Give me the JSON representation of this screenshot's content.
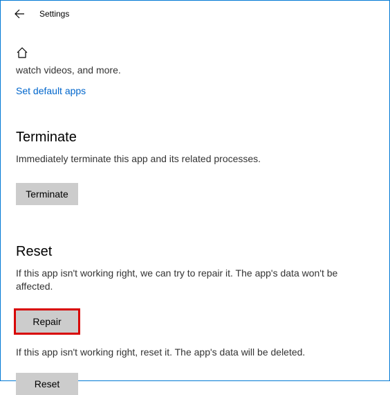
{
  "header": {
    "title": "Settings"
  },
  "truncated": "watch videos, and more.",
  "link_default_apps": "Set default apps",
  "terminate": {
    "title": "Terminate",
    "desc": "Immediately terminate this app and its related processes.",
    "button": "Terminate"
  },
  "reset": {
    "title": "Reset",
    "desc1": "If this app isn't working right, we can try to repair it. The app's data won't be affected.",
    "repair_button": "Repair",
    "desc2": "If this app isn't working right, reset it. The app's data will be deleted.",
    "reset_button": "Reset"
  }
}
